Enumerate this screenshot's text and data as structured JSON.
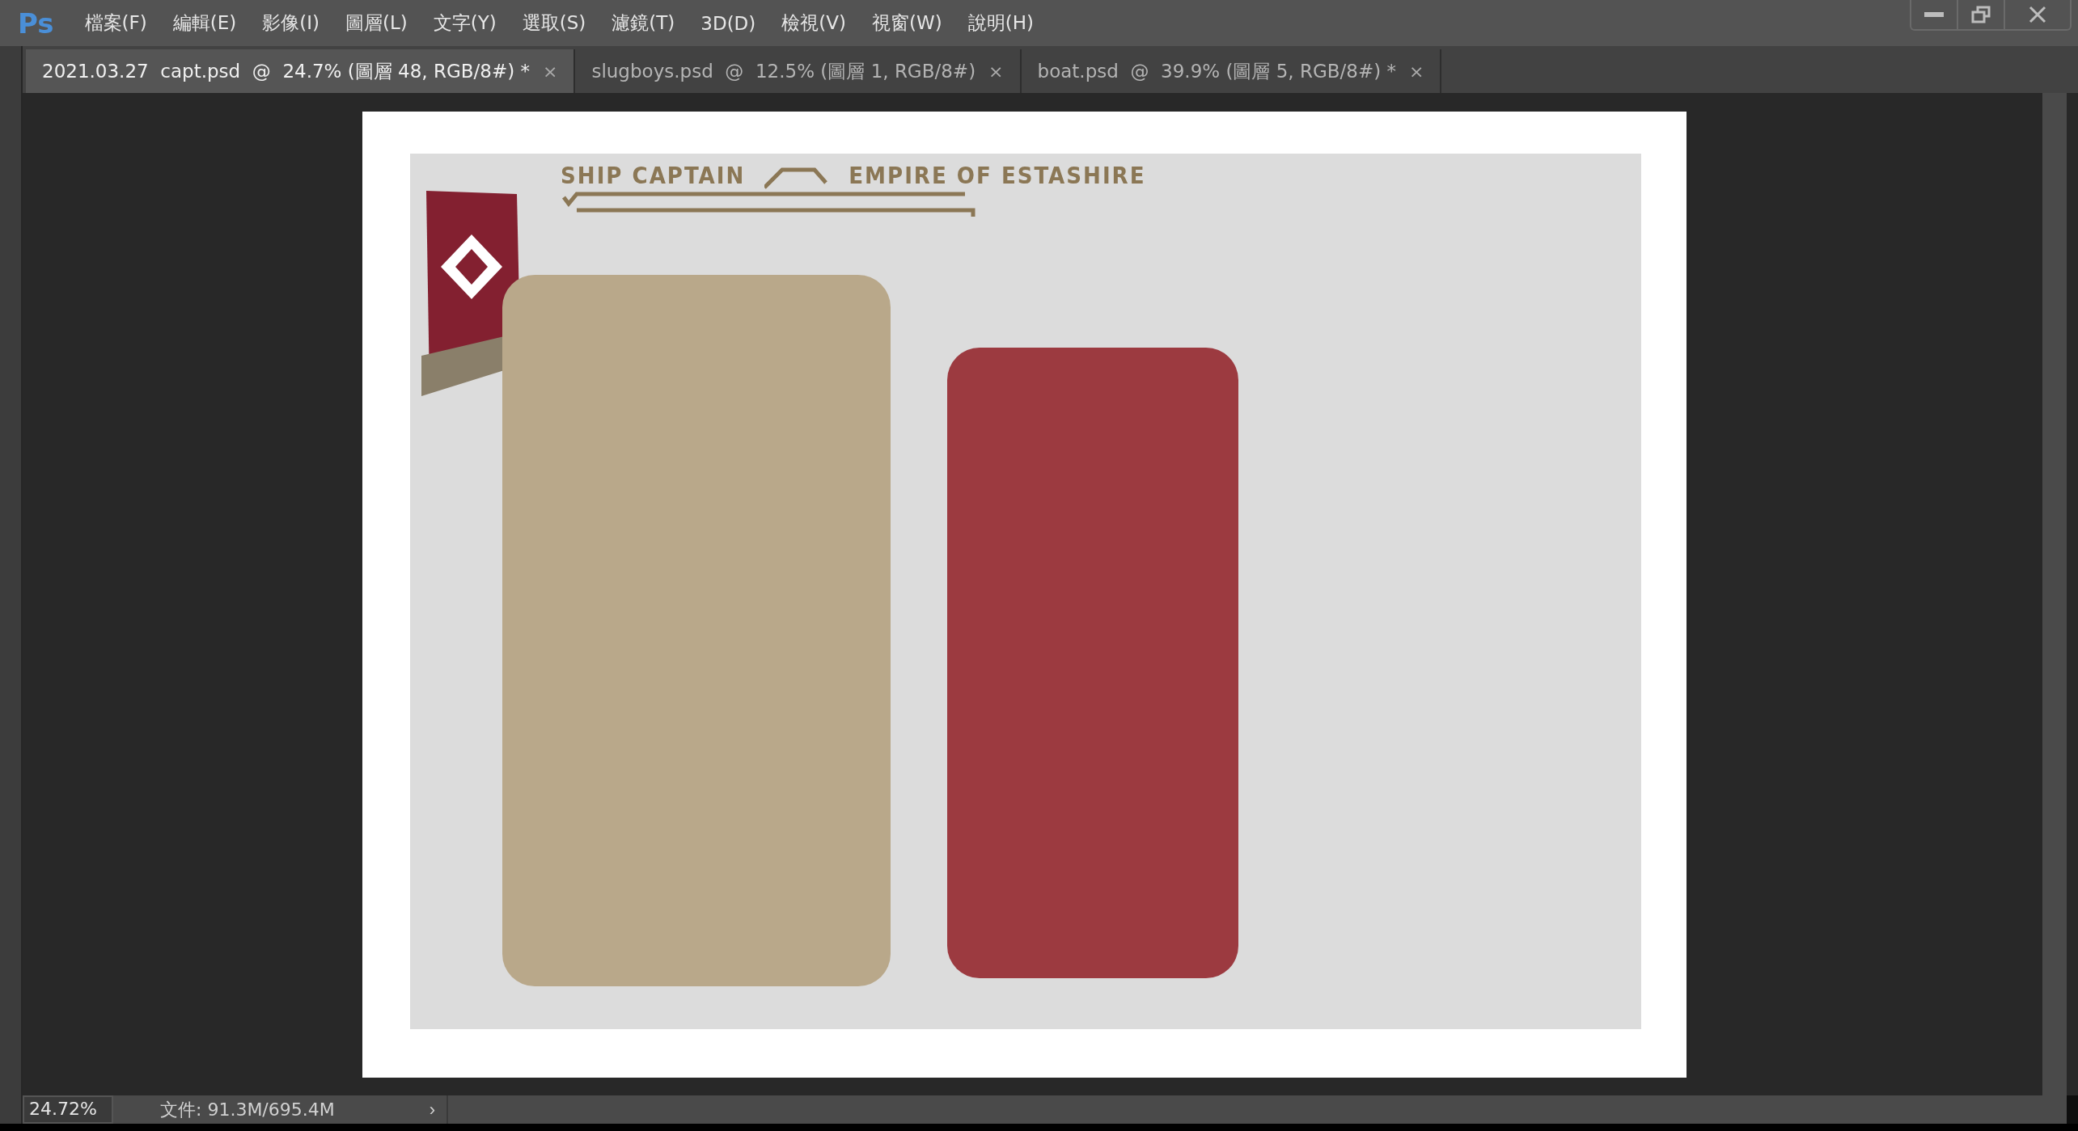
{
  "app": {
    "logo": "Ps"
  },
  "menu": [
    "檔案(F)",
    "編輯(E)",
    "影像(I)",
    "圖層(L)",
    "文字(Y)",
    "選取(S)",
    "濾鏡(T)",
    "3D(D)",
    "檢視(V)",
    "視窗(W)",
    "說明(H)"
  ],
  "tabs": [
    {
      "label": "2021.03.27  capt.psd  @  24.7% (圖層 48, RGB/8#) *",
      "close": "×",
      "selected": true
    },
    {
      "label": "slugboys.psd  @  12.5% (圖層 1, RGB/8#)",
      "close": "×",
      "selected": false
    },
    {
      "label": "boat.psd  @  39.9% (圖層 5, RGB/8#) *",
      "close": "×",
      "selected": false
    }
  ],
  "artwork": {
    "title_left": "SHIP CAPTAIN",
    "title_right": "EMPIRE OF ESTASHIRE"
  },
  "status_bar": {
    "zoom": "24.72%",
    "doc_size": "文件: 91.3M/695.4M",
    "arrow": "›"
  }
}
